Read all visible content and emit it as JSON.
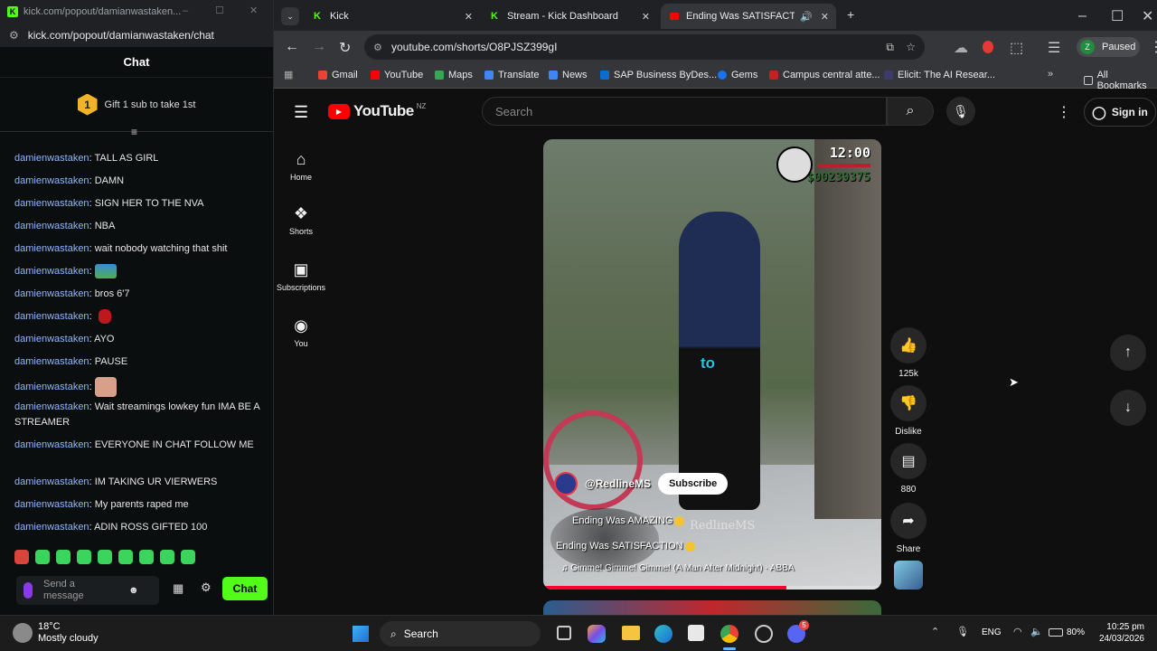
{
  "kick_window": {
    "title": "kick.com/popout/damianwastaken...",
    "url": "kick.com/popout/damianwastaken/chat",
    "chat_header": "Chat",
    "gift_badge": "1",
    "gift_text": "Gift 1 sub to take 1st",
    "messages": [
      {
        "user": "damienwastaken",
        "text": "TALL AS GIRL"
      },
      {
        "user": "damienwastaken",
        "text": "DAMN"
      },
      {
        "user": "damienwastaken",
        "text": "SIGN HER TO THE NVA"
      },
      {
        "user": "damienwastaken",
        "text": "NBA"
      },
      {
        "user": "damienwastaken",
        "text": "wait nobody watching that shit"
      },
      {
        "user": "damienwastaken",
        "text": ""
      },
      {
        "user": "damienwastaken",
        "text": "bros 6'7"
      },
      {
        "user": "damienwastaken",
        "text": ""
      },
      {
        "user": "damienwastaken",
        "text": "AYO"
      },
      {
        "user": "damienwastaken",
        "text": "PAUSE"
      },
      {
        "user": "damienwastaken",
        "text": ""
      },
      {
        "user": "damienwastaken",
        "text": "Wait streamings lowkey fun IMA BE A STREAMER"
      },
      {
        "user": "damienwastaken",
        "text": "EVERYONE IN CHAT FOLLOW ME"
      },
      {
        "user": "damienwastaken",
        "text": "IM TAKING UR VIERWERS"
      },
      {
        "user": "damienwastaken",
        "text": "My parents raped me"
      },
      {
        "user": "damienwastaken",
        "text": "ADIN ROSS GIFTED 100"
      }
    ],
    "placeholder": "Send a message",
    "chat_button": "Chat"
  },
  "browser": {
    "tabs": [
      {
        "label": "Kick"
      },
      {
        "label": "Stream - Kick Dashboard"
      },
      {
        "label": "Ending Was SATISFACTION"
      }
    ],
    "url": "youtube.com/shorts/O8PJSZ399gI",
    "profile_initial": "Z",
    "profile_status": "Paused",
    "bookmarks": [
      "Gmail",
      "YouTube",
      "Maps",
      "Translate",
      "News",
      "SAP Business ByDes...",
      "Gems",
      "Campus central atte...",
      "Elicit: The AI Resear...",
      "All Bookmarks"
    ],
    "bookmark_colors": [
      "#ea4335",
      "#ff0000",
      "#34a853",
      "#4285f4",
      "#4285f4",
      "#0a6ed1",
      "#1a73e8",
      "#c5221f",
      "#3b3b6d",
      "#e8eaed"
    ]
  },
  "youtube": {
    "logo": "YouTube",
    "region": "NZ",
    "search_placeholder": "Search",
    "sign_in": "Sign in",
    "nav": [
      "Home",
      "Shorts",
      "Subscriptions",
      "You"
    ],
    "video": {
      "hud_time": "12:00",
      "hud_money": "$00239375",
      "caption": "to",
      "channel": "@RedlineMS",
      "subscribe": "Subscribe",
      "title_line1": "Ending Was AMAZING",
      "watermark": "RedlineMS",
      "title_line2": "Ending Was SATISFACTION",
      "music": "Gimme! Gimme! Gimme! (A Man After Midnight) · ABBA",
      "progress": 0.72
    },
    "actions": {
      "likes": "125k",
      "dislike": "Dislike",
      "comments": "880",
      "share": "Share"
    }
  },
  "taskbar": {
    "weather_temp": "18°C",
    "weather_text": "Mostly cloudy",
    "search": "Search",
    "lang": "ENG",
    "battery": "80%",
    "time": "10:25 pm",
    "date": "24/03/2026",
    "discord_badge": "5"
  }
}
